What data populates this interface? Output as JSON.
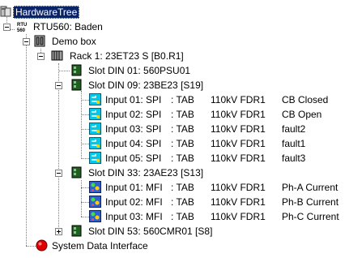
{
  "tree": {
    "root": {
      "label": "HardwareTree"
    },
    "rtu": {
      "label": "RTU560: Baden"
    },
    "demo": {
      "label": "Demo box"
    },
    "rack": {
      "label": "Rack 1: 23ET23 S [B0.R1]"
    },
    "slot01": {
      "label": "Slot DIN 01: 560PSU01"
    },
    "slot09": {
      "label": "Slot DIN 09: 23BE23 [S19]"
    },
    "slot09_inputs": [
      {
        "name": "Input 01: SPI",
        "type": ": TAB",
        "feeder": "110kV FDR1",
        "desc": "CB Closed"
      },
      {
        "name": "Input 02: SPI",
        "type": ": TAB",
        "feeder": "110kV FDR1",
        "desc": "CB Open"
      },
      {
        "name": "Input 03: SPI",
        "type": ": TAB",
        "feeder": "110kV FDR1",
        "desc": "fault2"
      },
      {
        "name": "Input 04: SPI",
        "type": ": TAB",
        "feeder": "110kV FDR1",
        "desc": "fault1"
      },
      {
        "name": "Input 05: SPI",
        "type": ": TAB",
        "feeder": "110kV FDR1",
        "desc": "fault3"
      }
    ],
    "slot33": {
      "label": "Slot DIN 33: 23AE23 [S13]"
    },
    "slot33_inputs": [
      {
        "name": "Input 01: MFI",
        "type": ": TAB",
        "feeder": "110kV FDR1",
        "desc": "Ph-A Current"
      },
      {
        "name": "Input 02: MFI",
        "type": ": TAB",
        "feeder": "110kV FDR1",
        "desc": "Ph-B Current"
      },
      {
        "name": "Input 03: MFI",
        "type": ": TAB",
        "feeder": "110kV FDR1",
        "desc": "Ph-C Current"
      }
    ],
    "slot53": {
      "label": "Slot DIN 53: 560CMR01 [S8]"
    },
    "sdi": {
      "label": "System Data Interface"
    }
  },
  "icons": {
    "rtu_badge": "RTU 560",
    "selection_color": "#0a246a",
    "board_color": "#1f5f1f",
    "status_red": "#e00000"
  }
}
